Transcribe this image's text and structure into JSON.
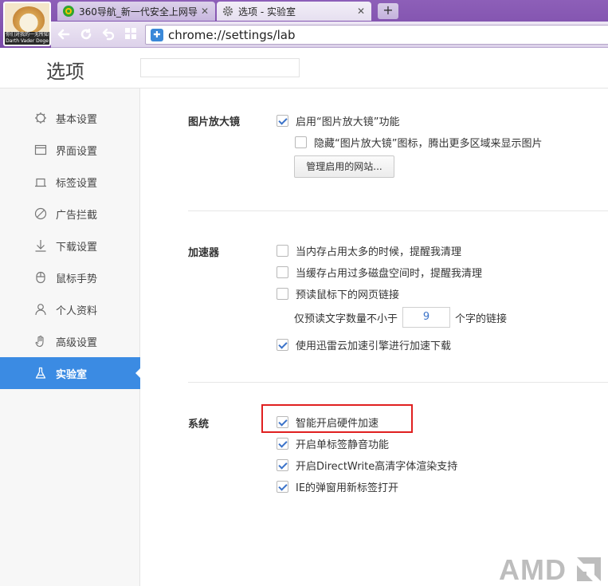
{
  "browser": {
    "tabs": [
      {
        "label": "360导航_新一代安全上网导",
        "icon": "360-icon",
        "close": "✕"
      },
      {
        "label": "选项 - 实验室",
        "icon": "gear-icon",
        "close": "✕"
      }
    ],
    "new_tab": "+",
    "avatar_caption": "你们对我的一无所知",
    "avatar_subcaption": "Darth Vader Doge",
    "url": "chrome://settings/lab"
  },
  "settings": {
    "title": "选项",
    "search_placeholder": "",
    "sidebar": [
      {
        "label": "基本设置",
        "icon": "gear-icon",
        "active": false
      },
      {
        "label": "界面设置",
        "icon": "window-icon",
        "active": false
      },
      {
        "label": "标签设置",
        "icon": "tab-icon",
        "active": false
      },
      {
        "label": "广告拦截",
        "icon": "block-icon",
        "active": false
      },
      {
        "label": "下载设置",
        "icon": "download-icon",
        "active": false
      },
      {
        "label": "鼠标手势",
        "icon": "mouse-icon",
        "active": false
      },
      {
        "label": "个人资料",
        "icon": "user-icon",
        "active": false
      },
      {
        "label": "高级设置",
        "icon": "hand-icon",
        "active": false
      },
      {
        "label": "实验室",
        "icon": "flask-icon",
        "active": true
      }
    ],
    "sections": {
      "magnifier": {
        "title": "图片放大镜",
        "enable": {
          "label": "启用“图片放大镜”功能",
          "checked": true
        },
        "hide_icon": {
          "label": "隐藏“图片放大镜”图标，腾出更多区域来显示图片",
          "checked": false
        },
        "manage_button": "管理启用的网站..."
      },
      "accelerator": {
        "title": "加速器",
        "mem_warn": {
          "label": "当内存占用太多的时候，提醒我清理",
          "checked": false
        },
        "cache_warn": {
          "label": "当缓存占用过多磁盘空间时，提醒我清理",
          "checked": false
        },
        "preload": {
          "label": "预读鼠标下的网页链接",
          "checked": false
        },
        "preload_min_prefix": "仅预读文字数量不小于",
        "preload_min_value": "9",
        "preload_min_suffix": "个字的链接",
        "xunlei": {
          "label": "使用迅雷云加速引擎进行加速下载",
          "checked": true
        }
      },
      "system": {
        "title": "系统",
        "hw_accel": {
          "label": "智能开启硬件加速",
          "checked": true
        },
        "tab_mute": {
          "label": "开启单标签静音功能",
          "checked": true
        },
        "directwrite": {
          "label": "开启DirectWrite高清字体渲染支持",
          "checked": true
        },
        "ie_popup": {
          "label": "IE的弹窗用新标签打开",
          "checked": true
        }
      }
    }
  },
  "watermark": "AMD",
  "colors": {
    "accent": "#3b8be3",
    "titlebar": "#7a4aa8",
    "highlight": "#e02020"
  }
}
